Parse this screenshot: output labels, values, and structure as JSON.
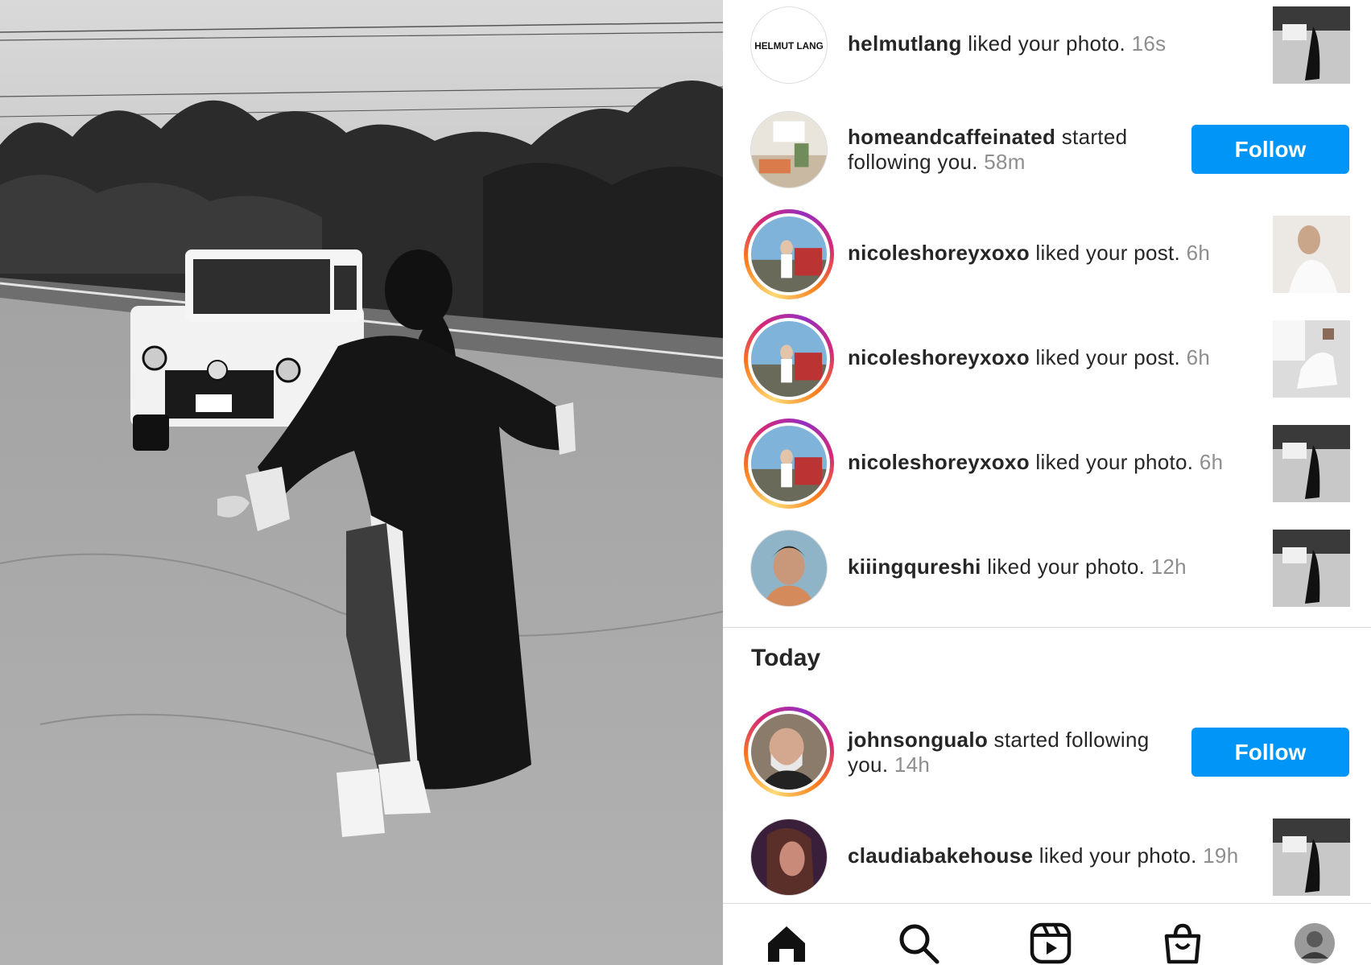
{
  "notifications": [
    {
      "username": "helmutlang",
      "action": " liked your photo.",
      "time": "16s",
      "avatar_text": "HELMUT LANG",
      "avatar_icon": "helmut-lang-logo",
      "thumbnail": "car-photo"
    },
    {
      "username": "homeandcaffeinated",
      "action": " started following you.",
      "time": "58m",
      "avatar_icon": "living-room-avatar",
      "button": "Follow"
    },
    {
      "username": "nicoleshoreyxoxo",
      "action": " liked your post.",
      "time": "6h",
      "avatar_icon": "nicole-avatar",
      "thumbnail": "white-outfit-photo"
    },
    {
      "username": "nicoleshoreyxoxo",
      "action": " liked your post.",
      "time": "6h",
      "avatar_icon": "nicole-avatar",
      "thumbnail": "window-photo"
    },
    {
      "username": "nicoleshoreyxoxo",
      "action": " liked your photo.",
      "time": "6h",
      "avatar_icon": "nicole-avatar",
      "thumbnail": "car-photo"
    },
    {
      "username": "kiiingqureshi",
      "action": " liked your photo.",
      "time": "12h",
      "avatar_icon": "man-avatar",
      "thumbnail": "car-photo"
    }
  ],
  "section_today": "Today",
  "today": [
    {
      "username": "johnsongualo",
      "action": " started following you.",
      "time": "14h",
      "avatar_icon": "bearded-man-avatar",
      "button": "Follow"
    },
    {
      "username": "claudiabakehouse",
      "action": " liked your photo.",
      "time": "19h",
      "avatar_icon": "woman-avatar",
      "thumbnail": "car-photo"
    }
  ],
  "nav": [
    "home-icon",
    "search-icon",
    "reels-icon",
    "shop-icon",
    "profile-icon"
  ],
  "colors": {
    "follow_button": "#0095f6",
    "secondary_text": "#8e8e8e",
    "primary_text": "#262626",
    "divider": "#dbdbdb"
  }
}
